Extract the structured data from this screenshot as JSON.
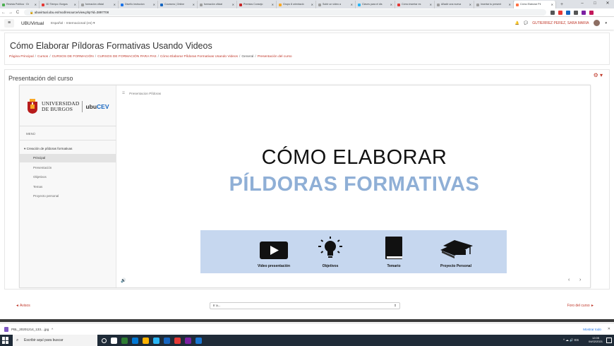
{
  "browser": {
    "tabs": [
      {
        "title": "Revista Política · Gr",
        "color": "#4caf50"
      },
      {
        "title": "3D Tiempo: Burgos",
        "color": "#e53935"
      },
      {
        "title": "formación oficial",
        "color": "#9e9e9e"
      },
      {
        "title": "Diseño instrucion",
        "color": "#1a73e8"
      },
      {
        "title": "Coursera | Online",
        "color": "#1565c0"
      },
      {
        "title": "formación oficial",
        "color": "#9e9e9e"
      },
      {
        "title": "Premios Consejo",
        "color": "#c62828"
      },
      {
        "title": "Grupo 8 orientació",
        "color": "#f9a825"
      },
      {
        "title": "Subir un video a",
        "color": "#9e9e9e"
      },
      {
        "title": "Claves para el dis",
        "color": "#29b6f6"
      },
      {
        "title": "Cómo insertar es",
        "color": "#e53935"
      },
      {
        "title": "Añadir una nueva",
        "color": "#9e9e9e"
      },
      {
        "title": "Insertar tu present",
        "color": "#9e9e9e"
      },
      {
        "title": "Cómo Elaborar Píl",
        "color": "#ff7043",
        "active": true
      }
    ],
    "new_tab": "+",
    "window_controls": [
      "–",
      "□",
      "✕"
    ],
    "url": "ubuvirtual.ubu.es/mod/resource/view.php?id=3897708",
    "extension_colors": [
      "#555",
      "#e53935",
      "#1565c0",
      "#555",
      "#7b1fa2",
      "#c2185b"
    ]
  },
  "navbar": {
    "menu_icon": "≡",
    "site_name": "UBUVirtual",
    "language": "Español - Internacional (es)",
    "language_caret": "▾",
    "bell": "🔔",
    "chat": "💬",
    "username": "GUTIERREZ PEREZ, SARA MARIA",
    "user_caret": "▾"
  },
  "header": {
    "title": "Cómo Elaborar Píldoras Formativas Usando Videos",
    "breadcrumb": [
      "Página Principal",
      "Cursos",
      "CURSOS DE FORMACIÓN",
      "CURSOS DE FORMACIÓN PARA PAS",
      "Cómo Elaborar Píldoras Formativas Usando Videos",
      "General",
      "Presentación del curso"
    ],
    "separator": "/"
  },
  "section": {
    "title": "Presentación del curso",
    "gear": "⚙ ▾"
  },
  "player": {
    "logo_line1": "UNIVERSIDAD",
    "logo_line2": "DE BURGOS",
    "logo_cev_prefix": "ubu",
    "logo_cev_suffix": "CEV",
    "menu_label": "MENÚ",
    "tree_root": "Creación de píldoras formativas",
    "tree_items": [
      {
        "label": "Principal",
        "selected": true
      },
      {
        "label": "Presentación",
        "selected": false
      },
      {
        "label": "Objetivos",
        "selected": false
      },
      {
        "label": "Temas",
        "selected": false
      },
      {
        "label": "Proyecto personal",
        "selected": false
      }
    ],
    "top_title": "Presentacion Píldoras",
    "heading_line1": "CÓMO ELABORAR",
    "heading_line2": "PÍLDORAS FORMATIVAS",
    "features": [
      {
        "label": "Video presentación",
        "icon": "play-icon"
      },
      {
        "label": "Objetivos",
        "icon": "lightbulb-icon"
      },
      {
        "label": "Temario",
        "icon": "book-icon"
      },
      {
        "label": "Proyecto Personal",
        "icon": "graduation-cap-icon"
      }
    ],
    "speaker": "🔊",
    "prev": "‹",
    "next": "›"
  },
  "activity_nav": {
    "prev": "◄ Avisos",
    "jump": "Ir a...",
    "jump_caret": "⇕",
    "next": "Foro del curso ►"
  },
  "downloads": {
    "file": "PBL_20201214_133....jpg",
    "caret": "^",
    "show_all": "Mostrar todo",
    "close": "✕"
  },
  "taskbar": {
    "search_placeholder": "Escribir aquí para buscar",
    "app_colors": [
      "#fff",
      "#fff",
      "#2e7d32",
      "#0078d4",
      "#ffb300",
      "#29b6f6",
      "#1565c0",
      "#e53935",
      "#7b1fa2",
      "#1976d2"
    ],
    "time": "12:05",
    "date": "04/02/2021",
    "tray": "^ ☁ 🔊 ES"
  }
}
